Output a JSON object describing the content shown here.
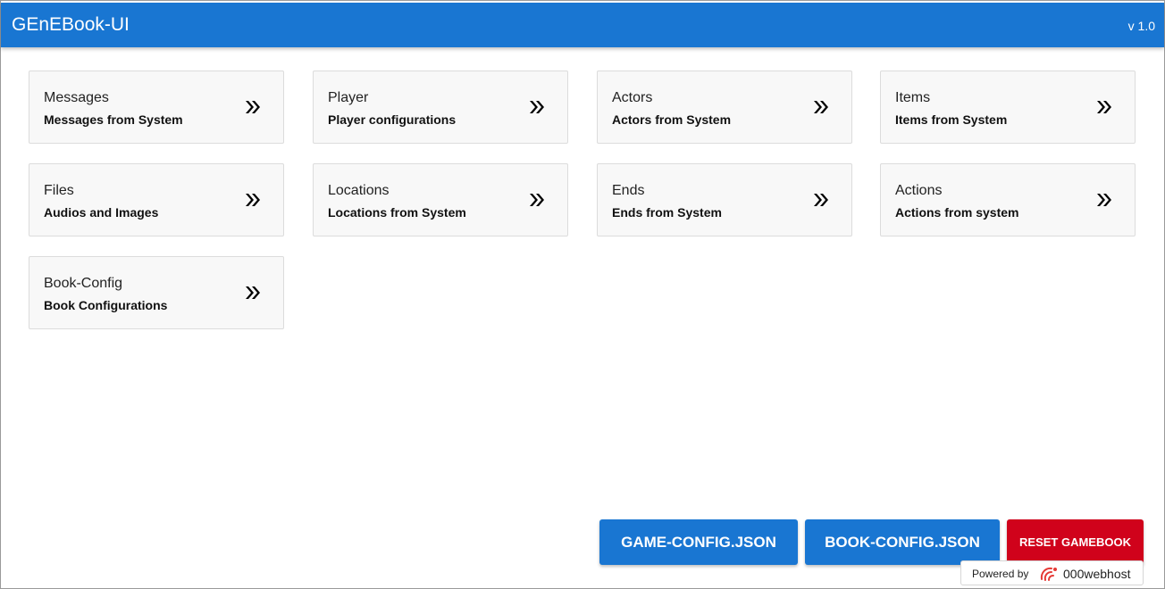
{
  "header": {
    "title": "GEnEBook-UI",
    "version": "v 1.0",
    "color": "#1976d2"
  },
  "cards": [
    {
      "title": "Messages",
      "subtitle": "Messages from System",
      "icon": "double-chevron-right-icon"
    },
    {
      "title": "Player",
      "subtitle": "Player configurations",
      "icon": "double-chevron-right-icon"
    },
    {
      "title": "Actors",
      "subtitle": "Actors from System",
      "icon": "double-chevron-right-icon"
    },
    {
      "title": "Items",
      "subtitle": "Items from System",
      "icon": "double-chevron-right-icon"
    },
    {
      "title": "Files",
      "subtitle": "Audios and Images",
      "icon": "double-chevron-right-icon"
    },
    {
      "title": "Locations",
      "subtitle": "Locations from System",
      "icon": "double-chevron-right-icon"
    },
    {
      "title": "Ends",
      "subtitle": "Ends from System",
      "icon": "double-chevron-right-icon"
    },
    {
      "title": "Actions",
      "subtitle": "Actions from system",
      "icon": "double-chevron-right-icon"
    },
    {
      "title": "Book-Config",
      "subtitle": "Book Configurations",
      "icon": "double-chevron-right-icon"
    }
  ],
  "actions": {
    "game_config": "GAME-CONFIG.JSON",
    "book_config": "BOOK-CONFIG.JSON",
    "reset": "RESET GAMEBOOK",
    "primary_color": "#1976d2",
    "danger_color": "#d0021b"
  },
  "footer_badge": {
    "powered_by": "Powered by",
    "brand": "000webhost",
    "brand_icon": "000webhost-logo-icon"
  }
}
